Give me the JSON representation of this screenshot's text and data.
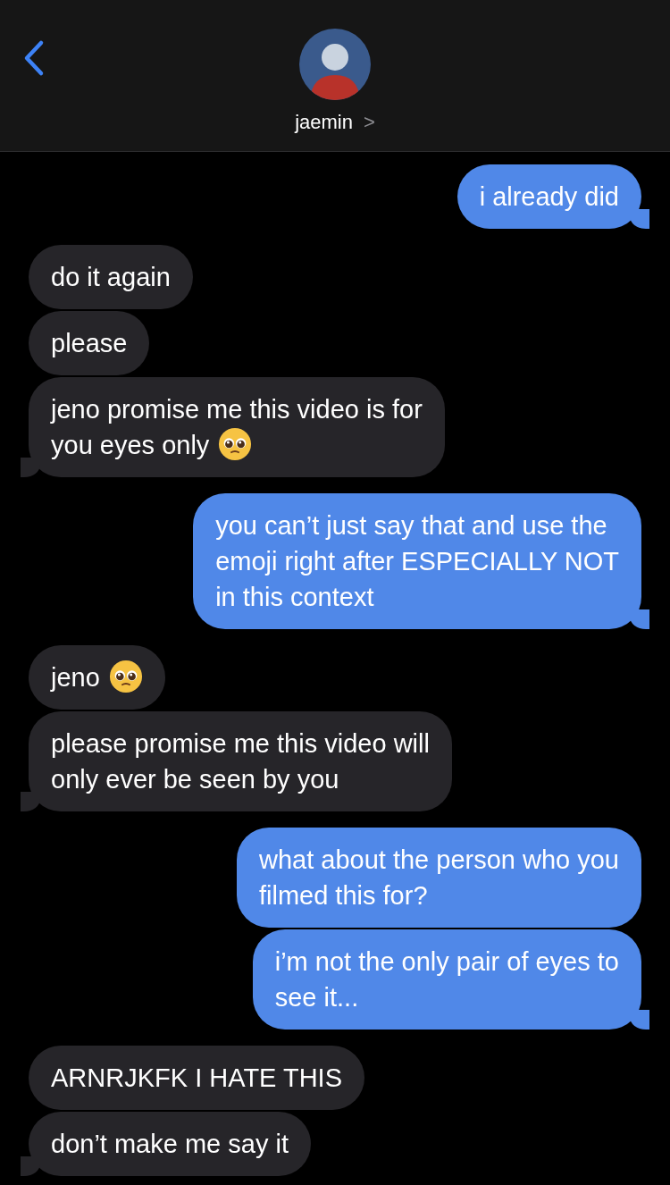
{
  "header": {
    "contact_name": "jaemin",
    "chevron": ">"
  },
  "messages": [
    {
      "kind": "sent",
      "text": "i already did",
      "tail": true,
      "emoji": false
    },
    {
      "kind": "received",
      "text": "do it again",
      "tail": false,
      "emoji": false
    },
    {
      "kind": "received",
      "text": "please",
      "tail": false,
      "emoji": false
    },
    {
      "kind": "received",
      "text": "jeno promise me this video is for\nyou eyes only",
      "tail": true,
      "emoji": true
    },
    {
      "kind": "sent",
      "text": "you can’t just say that and use the\nemoji right after ESPECIALLY NOT\nin this context",
      "tail": true,
      "emoji": false
    },
    {
      "kind": "received",
      "text": "jeno",
      "tail": false,
      "emoji": true
    },
    {
      "kind": "received",
      "text": "please promise me this video will\nonly ever be seen by you",
      "tail": true,
      "emoji": false
    },
    {
      "kind": "sent",
      "text": "what about the person who you\nfilmed this for?",
      "tail": false,
      "emoji": false
    },
    {
      "kind": "sent",
      "text": "i’m not the only pair of eyes to\nsee it...",
      "tail": true,
      "emoji": false
    },
    {
      "kind": "received",
      "text": "ARNRJKFK I HATE THIS",
      "tail": false,
      "emoji": false
    },
    {
      "kind": "received",
      "text": "don’t make me say it",
      "tail": true,
      "emoji": false
    }
  ]
}
